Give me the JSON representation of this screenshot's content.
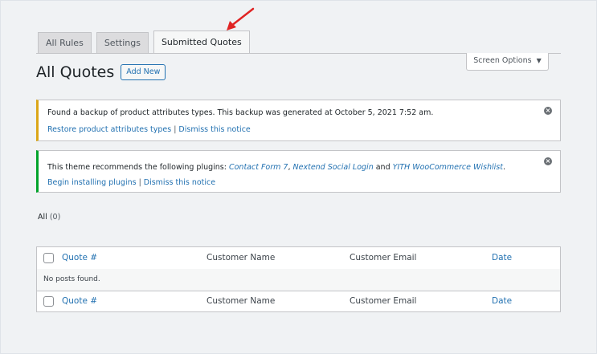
{
  "tabs": [
    {
      "label": "All Rules"
    },
    {
      "label": "Settings"
    },
    {
      "label": "Submitted Quotes"
    }
  ],
  "screen_options": {
    "label": "Screen Options",
    "caret": "▼"
  },
  "heading": {
    "title": "All Quotes",
    "add_new": "Add New"
  },
  "notice_backup": {
    "message": "Found a backup of product attributes types. This backup was generated at October 5, 2021 7:52 am.",
    "restore_link": "Restore product attributes types",
    "separator": "|",
    "dismiss_link": "Dismiss this notice"
  },
  "notice_plugins": {
    "prefix": "This theme recommends the following plugins: ",
    "plugin1": "Contact Form 7",
    "comma": ", ",
    "plugin2": "Nextend Social Login",
    "and": " and ",
    "plugin3": "YITH WooCommerce Wishlist",
    "period": ".",
    "install_link": "Begin installing plugins",
    "separator": "|",
    "dismiss_link": "Dismiss this notice"
  },
  "filter": {
    "label": "All",
    "count": "(0)"
  },
  "table": {
    "columns": [
      "Quote #",
      "Customer Name",
      "Customer Email",
      "Date"
    ],
    "empty_message": "No posts found."
  },
  "colors": {
    "warning": "#dba617",
    "success": "#00a32a",
    "link": "#2271b1",
    "arrow": "#e02424"
  }
}
